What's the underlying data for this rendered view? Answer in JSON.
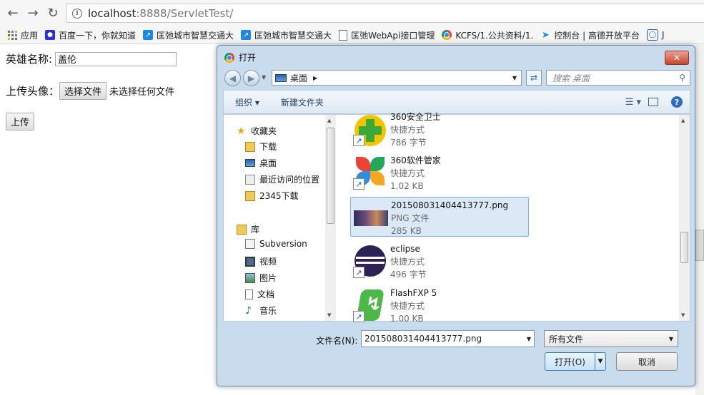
{
  "browser": {
    "url_host": "localhost",
    "url_path": ":8888/ServletTest/",
    "bookmarks": [
      {
        "label": "应用",
        "icon": "apps-grid-icon"
      },
      {
        "label": "百度一下，你就知道",
        "icon": "baidu-paw-icon"
      },
      {
        "label": "匡弛城市智慧交通大",
        "icon": "link-arrow-icon"
      },
      {
        "label": "匡弛城市智慧交通大",
        "icon": "link-arrow-icon"
      },
      {
        "label": "匡弛WebApi接口管理",
        "icon": "page-icon"
      },
      {
        "label": "KCFS/1.公共资料/1.",
        "icon": "chrome-icon"
      },
      {
        "label": "控制台 | 高德开放平台",
        "icon": "amap-icon"
      },
      {
        "label": "J",
        "icon": "globe-icon"
      }
    ]
  },
  "form": {
    "hero_label": "英雄名称:",
    "hero_value": "盖伦",
    "avatar_label": "上传头像：",
    "choose_file": "选择文件",
    "no_file": "未选择任何文件",
    "upload": "上传"
  },
  "dialog": {
    "title": "打开",
    "close": "✕",
    "location": "桌面",
    "search_placeholder": "搜索 桌面",
    "organize": "组织 ▾",
    "new_folder": "新建文件夹",
    "nav": {
      "favorites": "收藏夹",
      "downloads": "下载",
      "desktop": "桌面",
      "recent": "最近访问的位置",
      "dl2345": "2345下载",
      "libraries": "库",
      "subversion": "Subversion",
      "videos": "视频",
      "pictures": "图片",
      "documents": "文档",
      "music": "音乐"
    },
    "files": [
      {
        "name": "360安全卫士",
        "type": "快捷方式",
        "size": "786 字节"
      },
      {
        "name": "360软件管家",
        "type": "快捷方式",
        "size": "1.02 KB"
      },
      {
        "name": "201508031404413777.png",
        "type": "PNG 文件",
        "size": "285 KB"
      },
      {
        "name": "eclipse",
        "type": "快捷方式",
        "size": "496 字节"
      },
      {
        "name": "FlashFXP 5",
        "type": "快捷方式",
        "size": "1.00 KB"
      }
    ],
    "filename_label": "文件名(N):",
    "filename_value": "201508031404413777.png",
    "filetype": "所有文件",
    "open": "打开(O)",
    "cancel": "取消"
  },
  "colors": {
    "accent": "#3c7fb1",
    "selection": "#dbe9f7"
  }
}
